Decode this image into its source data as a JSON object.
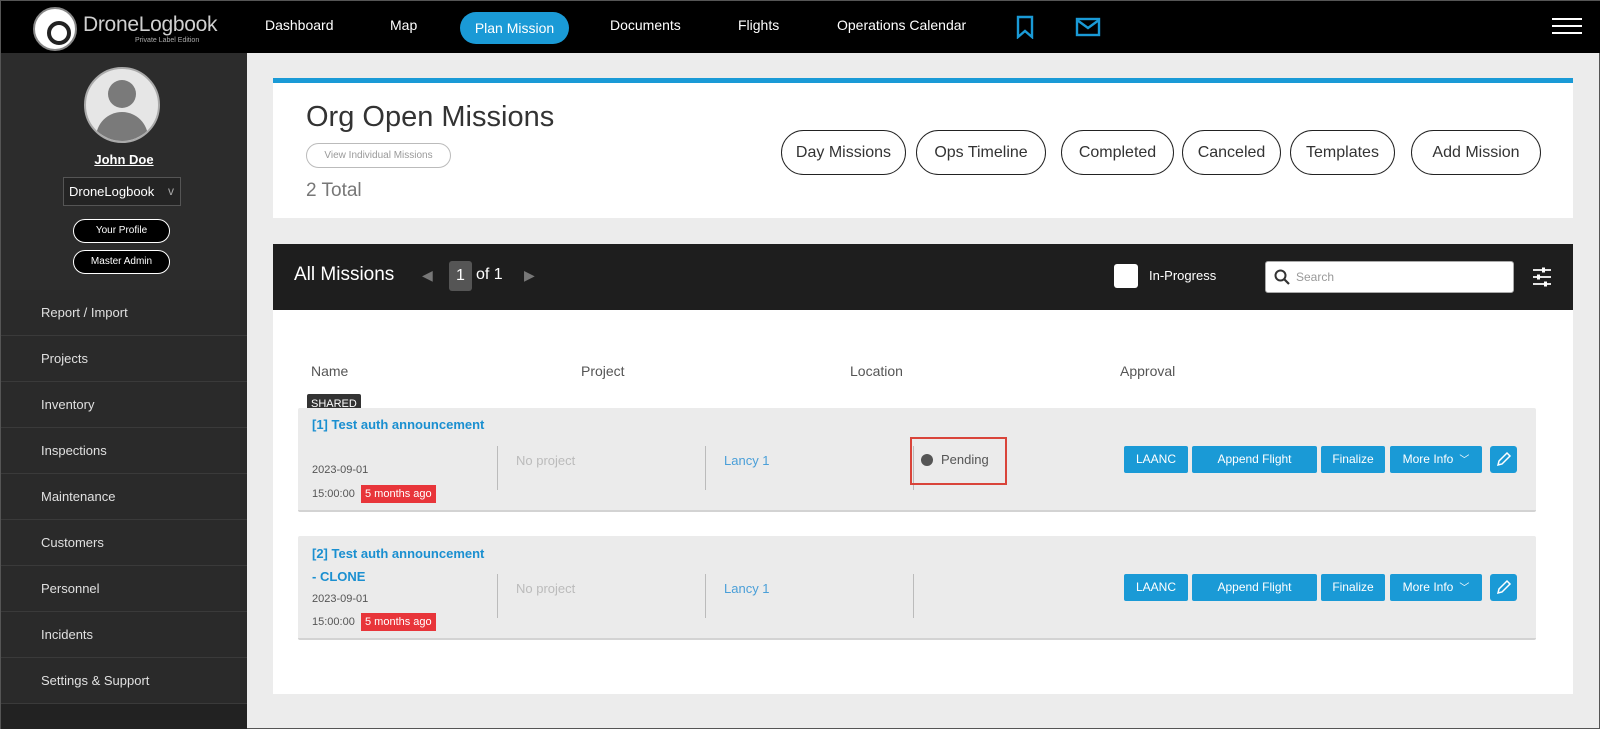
{
  "brand": {
    "name": "DroneLogbook",
    "subtitle": "Private Label Edition"
  },
  "nav": {
    "items": [
      "Dashboard",
      "Map",
      "Plan Mission",
      "Documents",
      "Flights",
      "Operations Calendar"
    ],
    "active": "Plan Mission"
  },
  "profile": {
    "name": "John Doe",
    "org": "DroneLogbook",
    "org_chevron": "v",
    "buttons": [
      "Your Profile",
      "Master Admin"
    ]
  },
  "sidebar": {
    "items": [
      "Report / Import",
      "Projects",
      "Inventory",
      "Inspections",
      "Maintenance",
      "Customers",
      "Personnel",
      "Incidents",
      "Settings & Support"
    ]
  },
  "header": {
    "title": "Org Open Missions",
    "view_individual": "View Individual Missions",
    "total": "2 Total",
    "buttons": [
      "Day Missions",
      "Ops Timeline",
      "Completed",
      "Canceled",
      "Templates",
      "Add Mission"
    ]
  },
  "missions": {
    "title": "All Missions",
    "page": "1",
    "of_pages": "of 1",
    "in_progress_label": "In-Progress",
    "search_placeholder": "Search",
    "columns": [
      "Name",
      "Project",
      "Location",
      "Approval"
    ],
    "shared_tag": "SHARED",
    "rows": [
      {
        "name": "[1] Test auth announcement",
        "date": "2023-09-01",
        "time": "15:00:00",
        "ago": "5 months ago",
        "project": "No project",
        "location": "Lancy 1",
        "approval": "Pending"
      },
      {
        "name": "[2] Test auth announcement - CLONE",
        "date": "2023-09-01",
        "time": "15:00:00",
        "ago": "5 months ago",
        "project": "No project",
        "location": "Lancy 1",
        "approval": ""
      }
    ],
    "actions": [
      "LAANC",
      "Append Flight",
      "Finalize",
      "More Info"
    ]
  },
  "colors": {
    "accent": "#1a9ad6",
    "badge_red": "#e8353a",
    "highlight": "#d9443a"
  }
}
